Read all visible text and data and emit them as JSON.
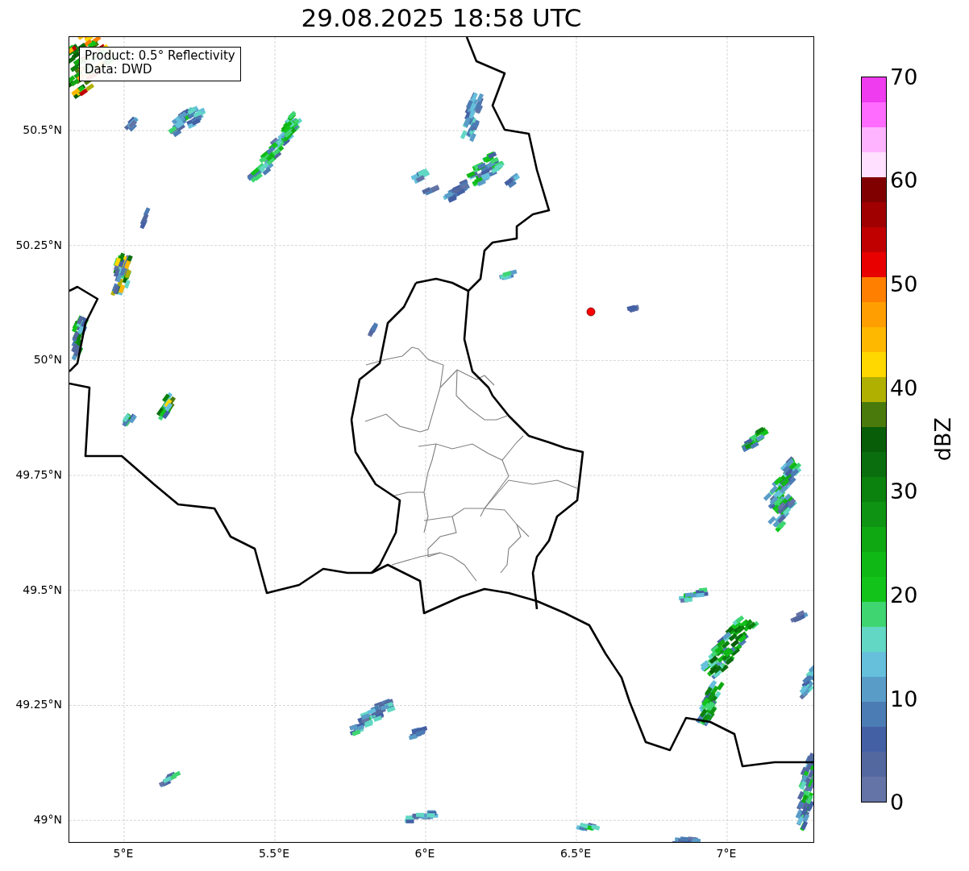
{
  "title": "29.08.2025 18:58 UTC",
  "info_box": {
    "lines": [
      "Product: 0.5° Reflectivity",
      "Data: DWD"
    ]
  },
  "map": {
    "lat_ticks": [
      "50.5°N",
      "50.25°N",
      "50°N",
      "49.75°N",
      "49.5°N",
      "49.25°N",
      "49°N"
    ],
    "lon_ticks": [
      "5°E",
      "5.5°E",
      "6°E",
      "6.5°E",
      "7°E"
    ]
  },
  "colorbar": {
    "label": "dBZ",
    "ticks": [
      "70",
      "60",
      "50",
      "40",
      "30",
      "20",
      "10",
      "0"
    ],
    "segments": [
      {
        "color": "#6474a6"
      },
      {
        "color": "#5468a0"
      },
      {
        "color": "#4460a4"
      },
      {
        "color": "#4c7cb4"
      },
      {
        "color": "#5a9cc8"
      },
      {
        "color": "#66c0dc"
      },
      {
        "color": "#62d8c4"
      },
      {
        "color": "#3fd672"
      },
      {
        "color": "#12c41a"
      },
      {
        "color": "#10b816"
      },
      {
        "color": "#10a812"
      },
      {
        "color": "#0e9412"
      },
      {
        "color": "#0c820e"
      },
      {
        "color": "#0a6e0e"
      },
      {
        "color": "#085e08"
      },
      {
        "color": "#4a7a0c"
      },
      {
        "color": "#b0b000"
      },
      {
        "color": "#ffd800"
      },
      {
        "color": "#ffb800"
      },
      {
        "color": "#ff9e00"
      },
      {
        "color": "#ff8000"
      },
      {
        "color": "#e80000"
      },
      {
        "color": "#c00000"
      },
      {
        "color": "#a00000"
      },
      {
        "color": "#800000"
      },
      {
        "color": "#ffe0ff"
      },
      {
        "color": "#ffb4ff"
      },
      {
        "color": "#ff6cff"
      },
      {
        "color": "#ee3cee"
      }
    ]
  }
}
